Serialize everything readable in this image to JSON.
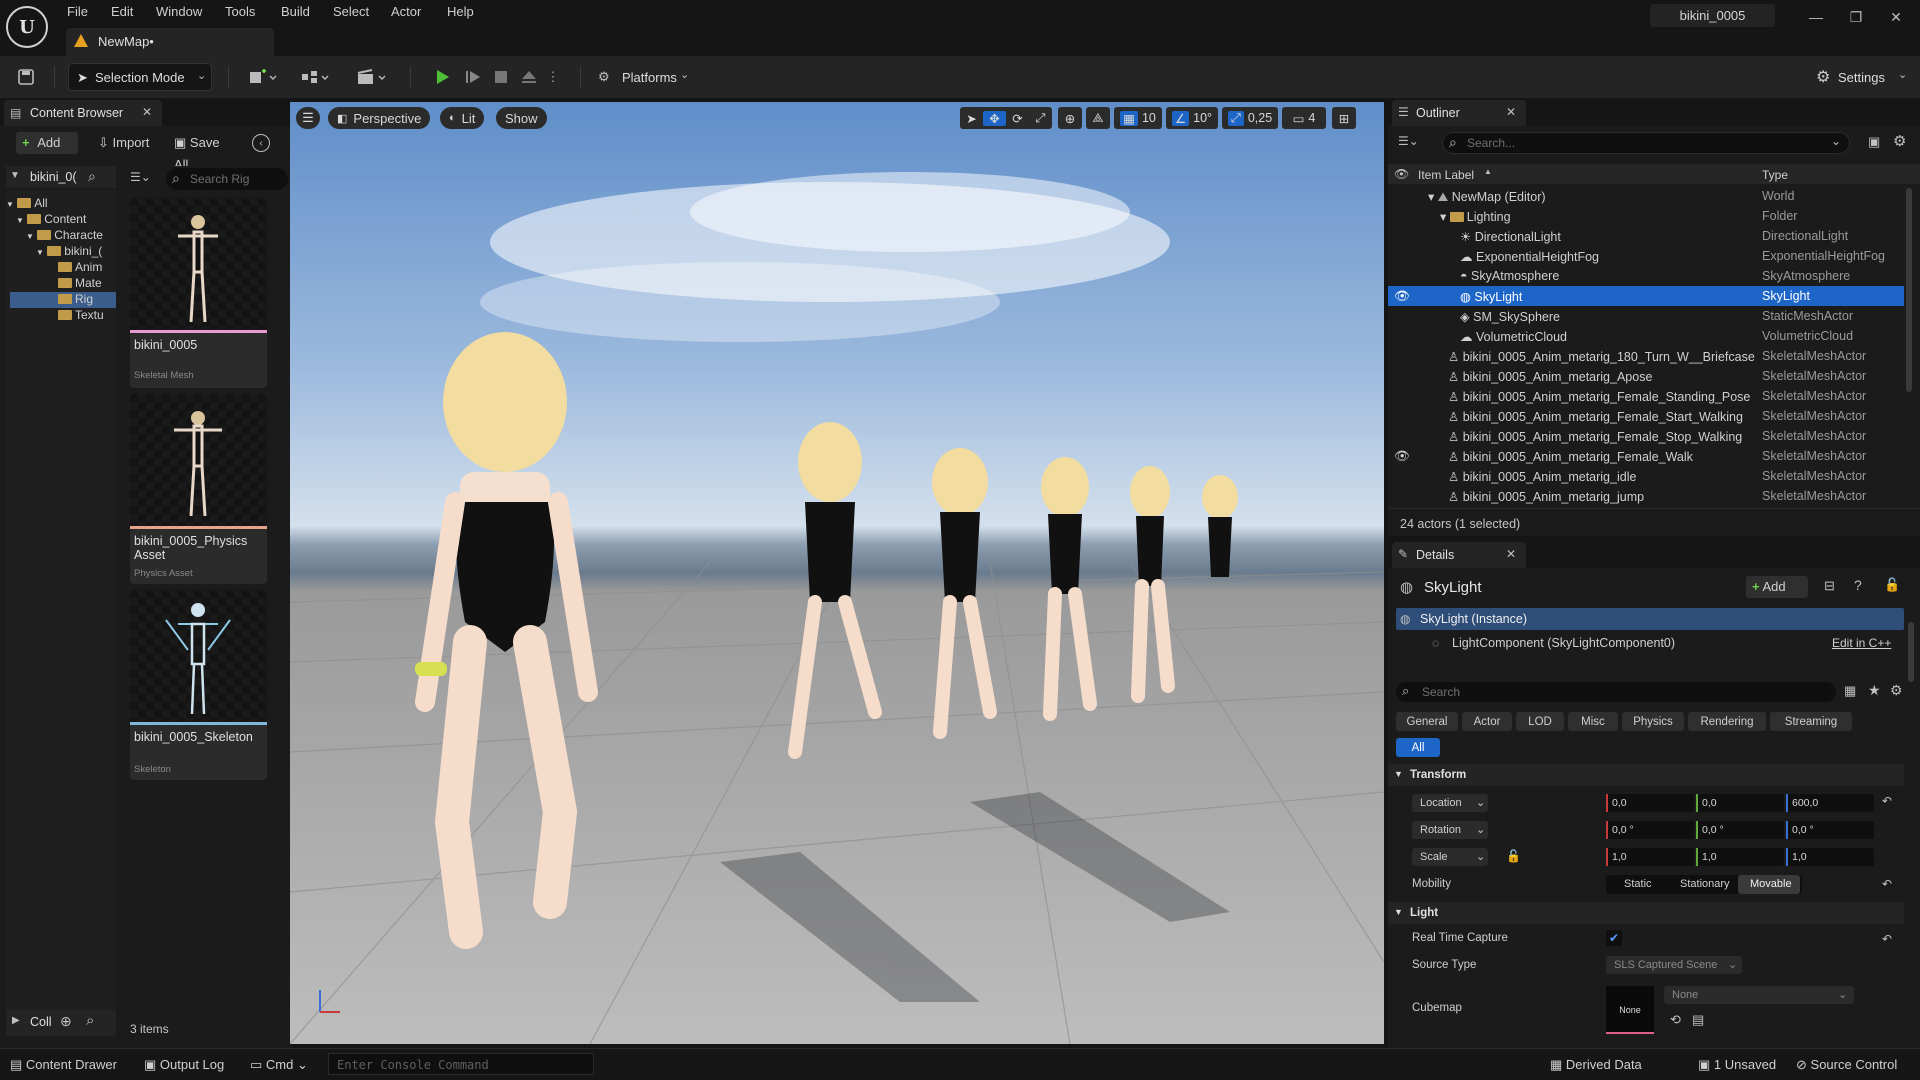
{
  "menu": [
    "File",
    "Edit",
    "Window",
    "Tools",
    "Build",
    "Select",
    "Actor",
    "Help"
  ],
  "document_tab": "NewMap•",
  "project_name": "bikini_0005",
  "toolbar": {
    "selection_mode": "Selection Mode",
    "platforms": "Platforms",
    "settings": "Settings"
  },
  "content_browser": {
    "tab_label": "Content Browser",
    "add_label": "Add",
    "import_label": "Import",
    "save_all_label": "Save All",
    "root_label": "bikini_0(",
    "search_placeholder": "Search Rig",
    "tree": [
      "All",
      "Content",
      "Characte",
      "bikini_(",
      "Anim",
      "Mate",
      "Rig",
      "Textu"
    ],
    "assets": [
      {
        "name": "bikini_0005",
        "type": "Skeletal Mesh",
        "accent": "#e89bd1"
      },
      {
        "name": "bikini_0005_Physics Asset",
        "type": "Physics Asset",
        "accent": "#e8a48a"
      },
      {
        "name": "bikini_0005_Skeleton",
        "type": "Skeleton",
        "accent": "#7fb6d9"
      }
    ],
    "collections_label": "Coll",
    "item_count": "3 items"
  },
  "viewport": {
    "perspective": "Perspective",
    "lit": "Lit",
    "show": "Show",
    "grid_snap": "10",
    "rotation_snap": "10°",
    "scale_snap": "0,25",
    "camera_speed": "4"
  },
  "outliner": {
    "tab_label": "Outliner",
    "search_placeholder": "Search...",
    "col_label": "Item Label",
    "col_type": "Type",
    "rows": [
      {
        "label": "NewMap (Editor)",
        "type": "World"
      },
      {
        "label": "Lighting",
        "type": "Folder"
      },
      {
        "label": "DirectionalLight",
        "type": "DirectionalLight"
      },
      {
        "label": "ExponentialHeightFog",
        "type": "ExponentialHeightFog"
      },
      {
        "label": "SkyAtmosphere",
        "type": "SkyAtmosphere"
      },
      {
        "label": "SkyLight",
        "type": "SkyLight"
      },
      {
        "label": "SM_SkySphere",
        "type": "StaticMeshActor"
      },
      {
        "label": "VolumetricCloud",
        "type": "VolumetricCloud"
      },
      {
        "label": "bikini_0005_Anim_metarig_180_Turn_W__Briefcase",
        "type": "SkeletalMeshActor"
      },
      {
        "label": "bikini_0005_Anim_metarig_Apose",
        "type": "SkeletalMeshActor"
      },
      {
        "label": "bikini_0005_Anim_metarig_Female_Standing_Pose",
        "type": "SkeletalMeshActor"
      },
      {
        "label": "bikini_0005_Anim_metarig_Female_Start_Walking",
        "type": "SkeletalMeshActor"
      },
      {
        "label": "bikini_0005_Anim_metarig_Female_Stop_Walking",
        "type": "SkeletalMeshActor"
      },
      {
        "label": "bikini_0005_Anim_metarig_Female_Walk",
        "type": "SkeletalMeshActor"
      },
      {
        "label": "bikini_0005_Anim_metarig_idle",
        "type": "SkeletalMeshActor"
      },
      {
        "label": "bikini_0005_Anim_metarig_jump",
        "type": "SkeletalMeshActor"
      }
    ],
    "status": "24 actors (1 selected)"
  },
  "details": {
    "tab_label": "Details",
    "actor_name": "SkyLight",
    "add_label": "Add",
    "instance_label": "SkyLight (Instance)",
    "component_label": "LightComponent (SkyLightComponent0)",
    "edit_cpp": "Edit in C++",
    "search_placeholder": "Search",
    "categories": [
      "General",
      "Actor",
      "LOD",
      "Misc",
      "Physics",
      "Rendering",
      "Streaming"
    ],
    "all_label": "All",
    "transform_section": "Transform",
    "location_label": "Location",
    "rotation_label": "Rotation",
    "scale_label": "Scale",
    "location": [
      "0,0",
      "0,0",
      "600,0"
    ],
    "rotation": [
      "0,0 °",
      "0,0 °",
      "0,0 °"
    ],
    "scale": [
      "1,0",
      "1,0",
      "1,0"
    ],
    "mobility_label": "Mobility",
    "mobility_options": [
      "Static",
      "Stationary",
      "Movable"
    ],
    "light_section": "Light",
    "real_time_capture_label": "Real Time Capture",
    "source_type_label": "Source Type",
    "source_type_value": "SLS Captured Scene",
    "cubemap_label": "Cubemap",
    "cubemap_thumb": "None",
    "cubemap_value": "None"
  },
  "statusbar": {
    "content_drawer": "Content Drawer",
    "output_log": "Output Log",
    "cmd": "Cmd",
    "console_placeholder": "Enter Console Command",
    "derived_data": "Derived Data",
    "unsaved": "1 Unsaved",
    "source_control": "Source Control"
  },
  "colors": {
    "accent": "#1d66c8",
    "play": "#4fbf3a"
  }
}
